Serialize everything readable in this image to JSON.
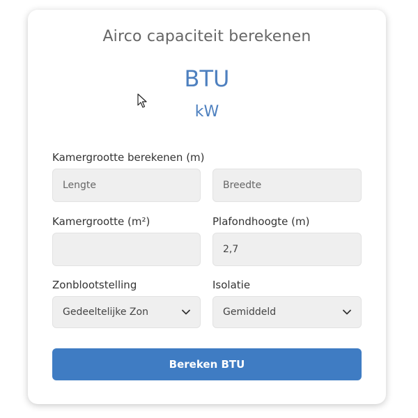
{
  "title": "Airco capaciteit berekenen",
  "result": {
    "btu_label": "BTU",
    "kw_label": "kW"
  },
  "room_size_section": {
    "label": "Kamergrootte berekenen (m)",
    "length_placeholder": "Lengte",
    "width_placeholder": "Breedte"
  },
  "room_area": {
    "label": "Kamergrootte (m²)",
    "value": ""
  },
  "ceiling_height": {
    "label": "Plafondhoogte (m)",
    "value": "2,7"
  },
  "sun_exposure": {
    "label": "Zonblootstelling",
    "selected": "Gedeeltelijke Zon"
  },
  "insulation": {
    "label": "Isolatie",
    "selected": "Gemiddeld"
  },
  "calculate_button": {
    "label": "Bereken BTU"
  },
  "icons": {
    "select_chevron": "chevron-down-icon",
    "cursor": "mouse-pointer-icon"
  },
  "colors": {
    "accent": "#3f7cc3",
    "result_text": "#4e80bf",
    "field_bg": "#efefef"
  }
}
